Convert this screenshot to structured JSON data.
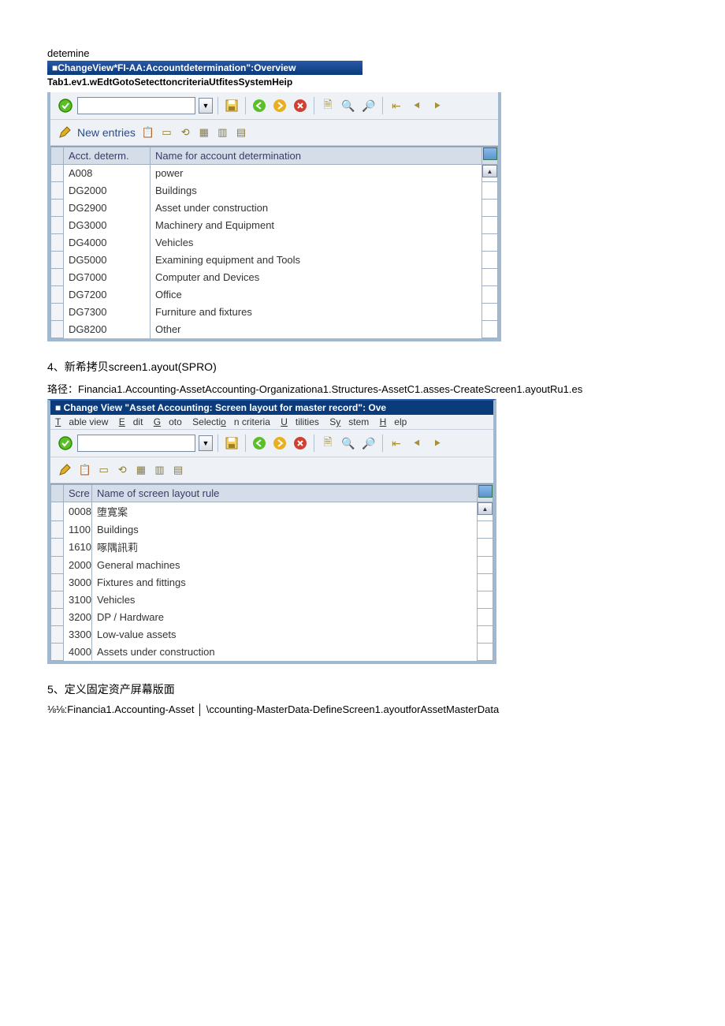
{
  "doc": {
    "header_word": "detemine",
    "win1_title": "■ChangeView*FI-AA:Accountdetermination\":Overview",
    "win1_menubar": "Tab1.ev1.wEdtGotoSetecttoncriteriaUtfitesSystemHeip",
    "sub_label": "New entries",
    "table1": {
      "col1": "Acct. determ.",
      "col2": "Name for account determination",
      "rows": [
        {
          "c1": "A008",
          "c2": "power"
        },
        {
          "c1": "DG2000",
          "c2": "Buildings"
        },
        {
          "c1": "DG2900",
          "c2": "Asset under construction"
        },
        {
          "c1": "DG3000",
          "c2": "Machinery and Equipment"
        },
        {
          "c1": "DG4000",
          "c2": "Vehicles"
        },
        {
          "c1": "DG5000",
          "c2": "Examining equipment and Tools"
        },
        {
          "c1": "DG7000",
          "c2": "Computer and Devices"
        },
        {
          "c1": "DG7200",
          "c2": "Office"
        },
        {
          "c1": "DG7300",
          "c2": "Furniture and fixtures"
        },
        {
          "c1": "DG8200",
          "c2": "Other"
        }
      ]
    },
    "section4_title": "4、新希拷贝screen1.ayout(SPRO)",
    "section4_path": "珞径：Financia1.Accounting-AssetAccounting-Organizationa1.Structures-AssetC1.asses-CreateScreen1.ayoutRu1.es",
    "win2_title": "Change View \"Asset Accounting: Screen layout for master record\": Ove",
    "win2_menu": {
      "m1": "Table view",
      "m2": "Edit",
      "m3": "Goto",
      "m4": "Selection criteria",
      "m5": "Utilities",
      "m6": "System",
      "m7": "Help"
    },
    "table2": {
      "col1": "Scre",
      "col2": "Name of screen layout rule",
      "rows": [
        {
          "c1": "0008",
          "c2": "堕寛案"
        },
        {
          "c1": "1100",
          "c2": "Buildings"
        },
        {
          "c1": "1610",
          "c2": "啄隅訊莉"
        },
        {
          "c1": "2000",
          "c2": "General machines"
        },
        {
          "c1": "3000",
          "c2": "Fixtures and fittings"
        },
        {
          "c1": "3100",
          "c2": "Vehicles"
        },
        {
          "c1": "3200",
          "c2": "DP / Hardware"
        },
        {
          "c1": "3300",
          "c2": "Low-value assets"
        },
        {
          "c1": "4000",
          "c2": "Assets under construction"
        }
      ]
    },
    "section5_title": "5、定义固定资产屏幕版面",
    "section5_path": "⅛⅛:Financia1.Accounting-Asset │ \\ccounting-MasterData-DefineScreen1.ayoutforAssetMasterData"
  }
}
